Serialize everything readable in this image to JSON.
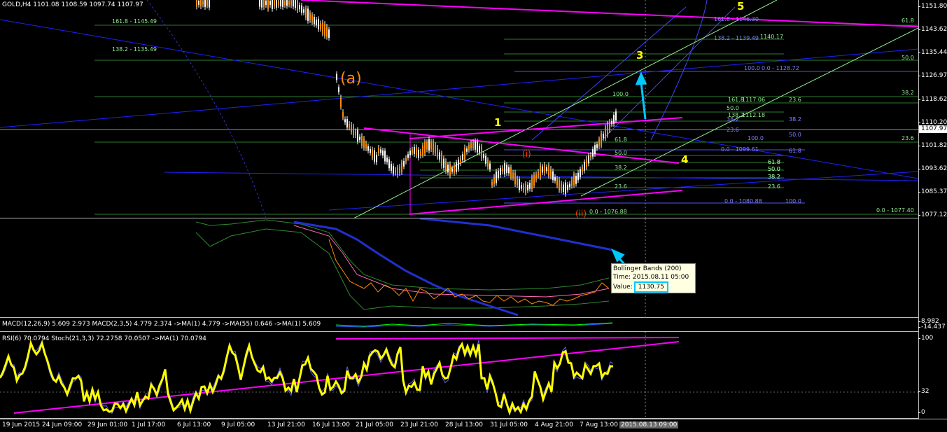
{
  "chart_header": {
    "symbol": "GOLD,H4",
    "ohlc": "1101.08 1108.59 1097.74 1107.97"
  },
  "price_axis": {
    "labels": [
      "1151.80",
      "1143.62",
      "1135.44",
      "1126.97",
      "1118.62",
      "1110.20",
      "1101.82",
      "1093.62",
      "1085.37",
      "1077.12"
    ],
    "current_price": "1107.97"
  },
  "wave_labels": {
    "a": "(a)",
    "one": "1",
    "three": "3",
    "four": "4",
    "five": "5",
    "i": "(i)",
    "ii": "(ii)"
  },
  "fib_labels": [
    "161.8 - 1145.49",
    "138.2 - 1135.49",
    "100.0",
    "161.8 - 1146.30",
    "138.2 - 1139.49",
    "1140.17",
    "100.0",
    "0.0 - 1128.72",
    "61.8",
    "50.0",
    "38.2",
    "23.6",
    "161.8",
    "1117.06",
    "50.0",
    "138.2",
    "1112.18",
    "38.2",
    "38.2",
    "23.6",
    "100.0",
    "50.0",
    "61.8",
    "50.0",
    "38.2",
    "23.6",
    "0.0 - 1099.61",
    "61.8",
    "61.8",
    "50.0",
    "38.2",
    "23.6",
    "0.0 - 1076.88",
    "0.0 - 1080.88",
    "100.0",
    "0.0 - 1077.40",
    "61.8",
    "50.0",
    "38.2",
    "23.6"
  ],
  "indicator1": {
    "tooltip_title": "Bollinger Bands (200)",
    "tooltip_time": "Time: 2015.08.11 05:00",
    "tooltip_value_label": "Value:",
    "tooltip_value": "1130.75"
  },
  "macd": {
    "header": "MACD(12,26,9) 5.609 2.973 MACD(2,3,5) 4.779 2.374 ->MA(1) 4.779 ->MA(55) 0.646 ->MA(1) 5.609",
    "axis_top": "8.982",
    "axis_bottom": "-14.437"
  },
  "rsi": {
    "header": "RSI(6) 70.0794 Stoch(21,3,3) 72.2758 70.0507 ->MA(1) 70.0794",
    "axis_labels": [
      "100",
      "32",
      "0"
    ]
  },
  "time_axis": {
    "labels": [
      "19 Jun 2015",
      "24 Jun 09:00",
      "29 Jun 01:00",
      "1 Jul 17:00",
      "6 Jul 13:00",
      "9 Jul 05:00",
      "13 Jul 21:00",
      "16 Jul 13:00",
      "21 Jul 05:00",
      "23 Jul 21:00",
      "28 Jul 13:00",
      "31 Jul 05:00",
      "4 Aug 21:00",
      "7 Aug 13:00"
    ],
    "cursor_label": "2015.08.13 09:00"
  },
  "colors": {
    "background": "#000000",
    "candle_up": "#ff8c00",
    "magenta_trend": "#ff00ff",
    "blue_trend": "#2020ff",
    "fib_green": "#2e8b2e",
    "wave_yellow": "#ffff00",
    "rsi_line": "#ffff00",
    "arrow_cyan": "#00c8ff"
  }
}
